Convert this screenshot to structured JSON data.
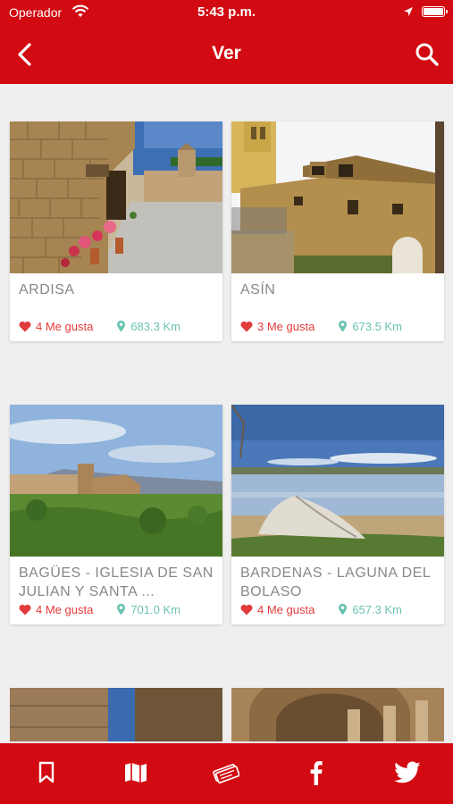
{
  "status_bar": {
    "carrier": "Operador",
    "time": "5:43 p.m."
  },
  "nav": {
    "title": "Ver"
  },
  "places": [
    {
      "name": "ARDISA",
      "likes": "4 Me gusta",
      "distance": "683.3 Km"
    },
    {
      "name": "ASÍN",
      "likes": "3 Me gusta",
      "distance": "673.5 Km"
    },
    {
      "name": "BAGÜES - IGLESIA DE SAN JULIAN Y SANTA ...",
      "likes": "4 Me gusta",
      "distance": "701.0 Km"
    },
    {
      "name": "BARDENAS - LAGUNA DEL BOLASO",
      "likes": "4 Me gusta",
      "distance": "657.3 Km"
    }
  ],
  "tabs": [
    "bookmark-icon",
    "map-icon",
    "tickets-icon",
    "facebook-icon",
    "twitter-icon"
  ],
  "colors": {
    "brand_red": "#d20a11",
    "like_red": "#e23b3b",
    "distance_teal": "#6cc3b4",
    "background": "#efefef"
  }
}
